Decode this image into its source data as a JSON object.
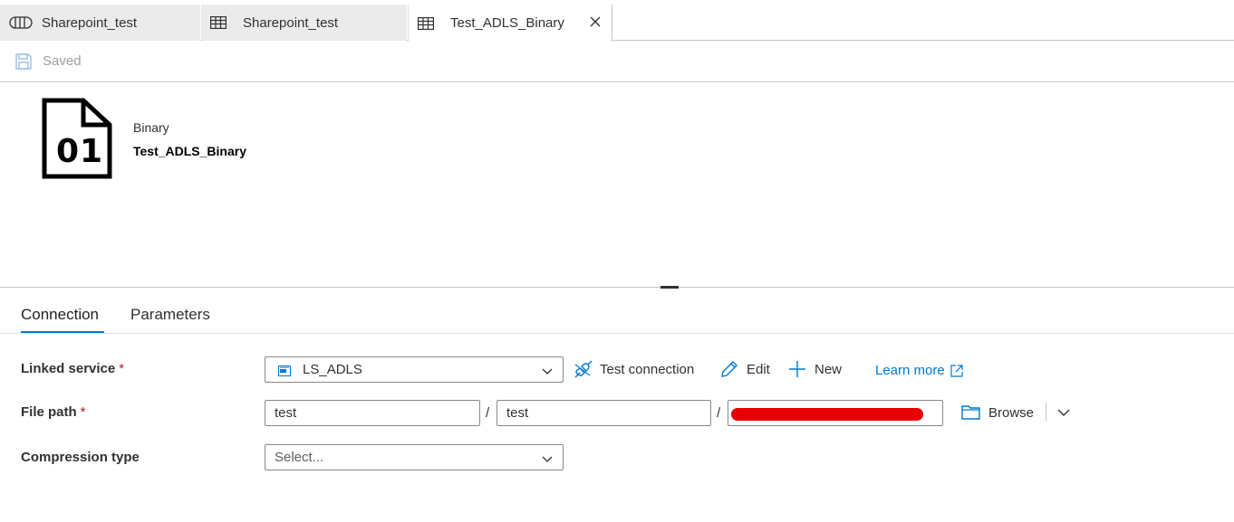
{
  "tabs": [
    {
      "label": "Sharepoint_test",
      "icon": "pipeline-icon"
    },
    {
      "label": "Sharepoint_test",
      "icon": "table-icon"
    },
    {
      "label": "Test_ADLS_Binary",
      "icon": "table-icon",
      "active": true
    }
  ],
  "toolbar": {
    "saved_label": "Saved"
  },
  "dataset": {
    "icon_text": "01",
    "type": "Binary",
    "name": "Test_ADLS_Binary"
  },
  "subtabs": [
    "Connection",
    "Parameters"
  ],
  "form": {
    "linked_service": {
      "label": "Linked service",
      "required_mark": "*",
      "value": "LS_ADLS",
      "test_connection": "Test connection",
      "edit": "Edit",
      "new": "New",
      "learn_more": "Learn more"
    },
    "file_path": {
      "label": "File path",
      "required_mark": "*",
      "container": "test",
      "directory": "test",
      "separator": "/",
      "browse": "Browse"
    },
    "compression": {
      "label": "Compression type",
      "placeholder": "Select..."
    }
  },
  "colors": {
    "accent": "#0078d4",
    "required": "#a4262c",
    "redaction": "#e60000"
  }
}
